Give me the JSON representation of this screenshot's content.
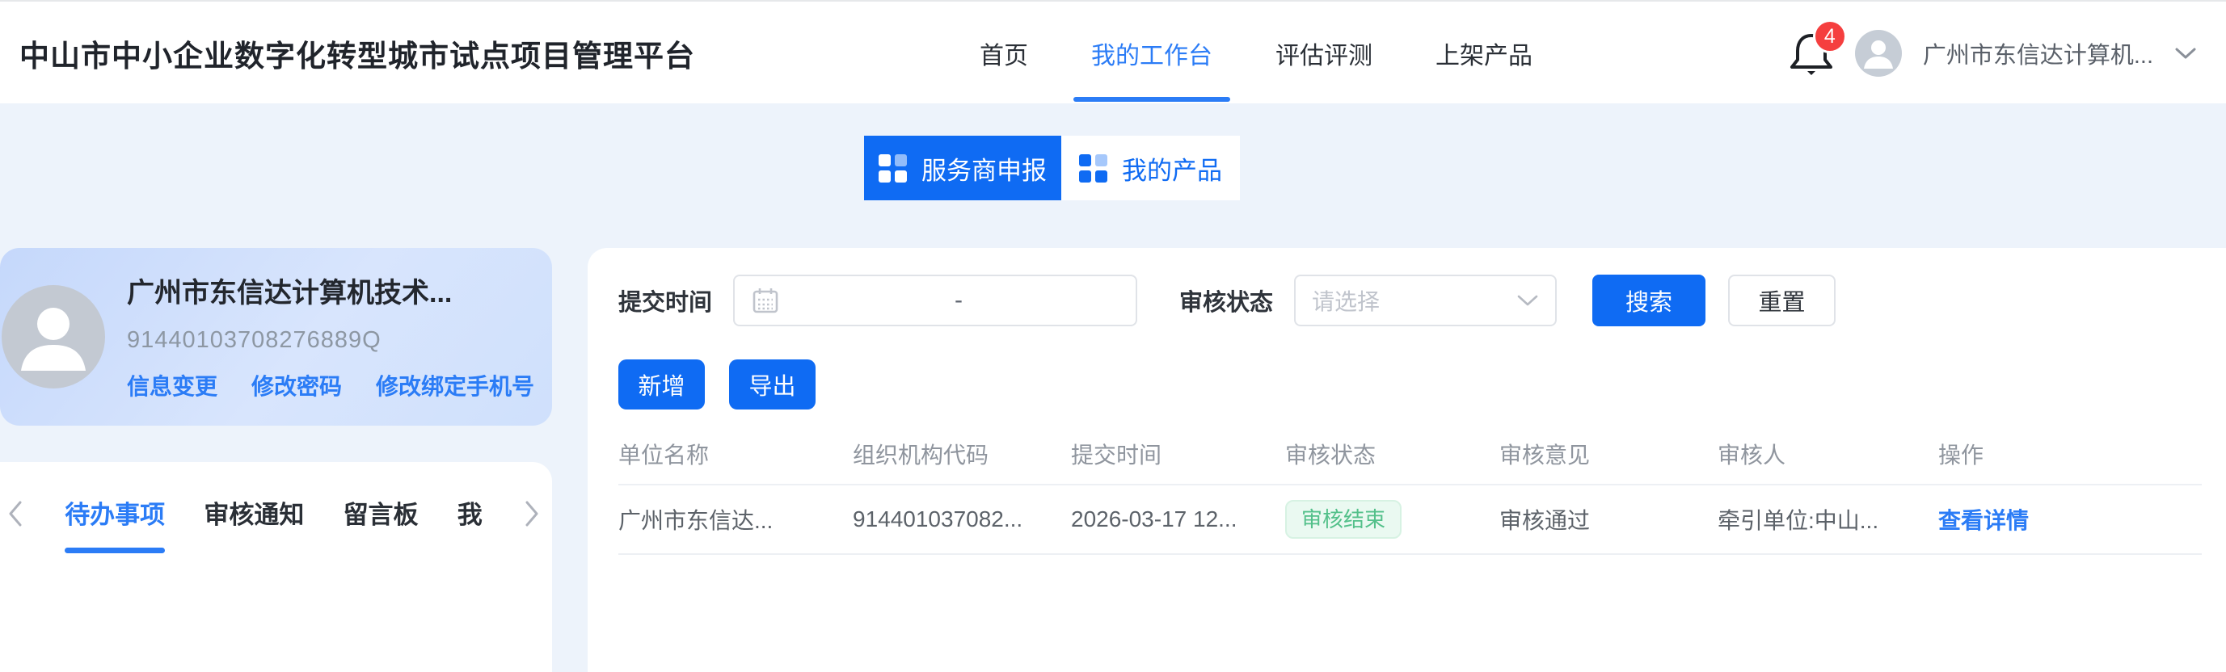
{
  "header": {
    "title": "中山市中小企业数字化转型城市试点项目管理平台",
    "nav": [
      {
        "label": "首页"
      },
      {
        "label": "我的工作台"
      },
      {
        "label": "评估评测"
      },
      {
        "label": "上架产品"
      }
    ],
    "notification_count": "4",
    "user_name": "广州市东信达计算机..."
  },
  "view_tabs": [
    {
      "label": "服务商申报"
    },
    {
      "label": "我的产品"
    }
  ],
  "profile_card": {
    "company_name": "广州市东信达计算机技术...",
    "org_code": "91440103708276889Q",
    "links": [
      {
        "label": "信息变更"
      },
      {
        "label": "修改密码"
      },
      {
        "label": "修改绑定手机号"
      }
    ]
  },
  "side_tabs": {
    "items": [
      {
        "label": "待办事项"
      },
      {
        "label": "审核通知"
      },
      {
        "label": "留言板"
      },
      {
        "label": "我"
      }
    ]
  },
  "filters": {
    "date_label": "提交时间",
    "date_separator": "-",
    "status_label": "审核状态",
    "status_placeholder": "请选择",
    "search_label": "搜索",
    "reset_label": "重置"
  },
  "actions": {
    "add_label": "新增",
    "export_label": "导出"
  },
  "table": {
    "columns": [
      "单位名称",
      "组织机构代码",
      "提交时间",
      "审核状态",
      "审核意见",
      "审核人",
      "操作"
    ],
    "rows": [
      {
        "unit_name": "广州市东信达...",
        "org_code": "914401037082...",
        "submit_time": "2026-03-17 12...",
        "status": "审核结束",
        "opinion": "审核通过",
        "reviewer": "牵引单位:中山...",
        "action": "查看详情"
      }
    ]
  },
  "colors": {
    "primary": "#0f6bf3",
    "link": "#2b7cf6",
    "badge_red": "#f53f3f",
    "status_green_text": "#53c08a",
    "status_green_bg": "#eaf9f1",
    "page_bg": "#edf3fb"
  }
}
